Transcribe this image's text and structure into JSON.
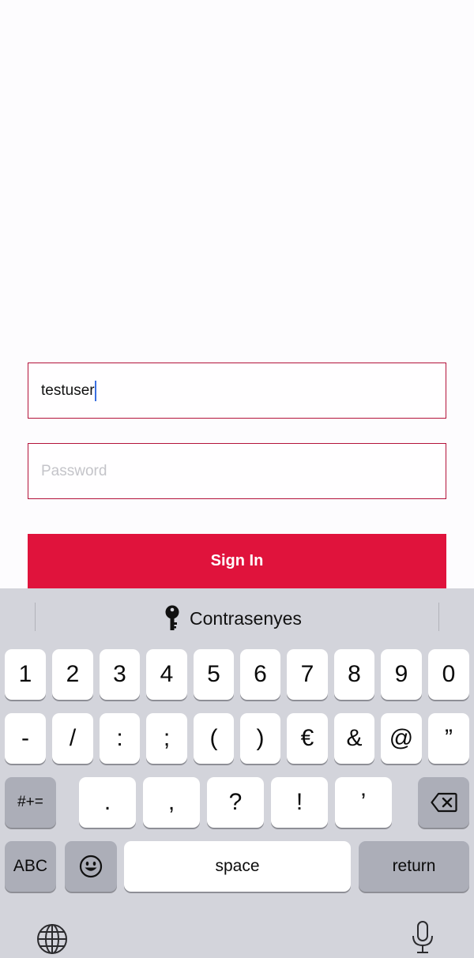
{
  "form": {
    "username_value": "testuser",
    "password_placeholder": "Password",
    "signin_label": "Sign In"
  },
  "keyboard": {
    "suggestion": {
      "icon": "key-icon",
      "label": "Contrasenyes"
    },
    "row1": [
      "1",
      "2",
      "3",
      "4",
      "5",
      "6",
      "7",
      "8",
      "9",
      "0"
    ],
    "row2": [
      "-",
      "/",
      ":",
      ";",
      "(",
      ")",
      "€",
      "&",
      "@",
      "”"
    ],
    "row3": {
      "mode_key": "#+=",
      "keys": [
        ".",
        ",",
        "?",
        "!",
        "’"
      ],
      "delete_icon": "backspace-icon"
    },
    "row4": {
      "abc_key": "ABC",
      "emoji_icon": "emoji-icon",
      "space_key": "space",
      "return_key": "return"
    },
    "bottom": {
      "globe_icon": "globe-icon",
      "mic_icon": "microphone-icon"
    }
  },
  "colors": {
    "accent": "#e0133c",
    "field_border": "#b3123a",
    "keyboard_bg": "#d3d4db"
  }
}
